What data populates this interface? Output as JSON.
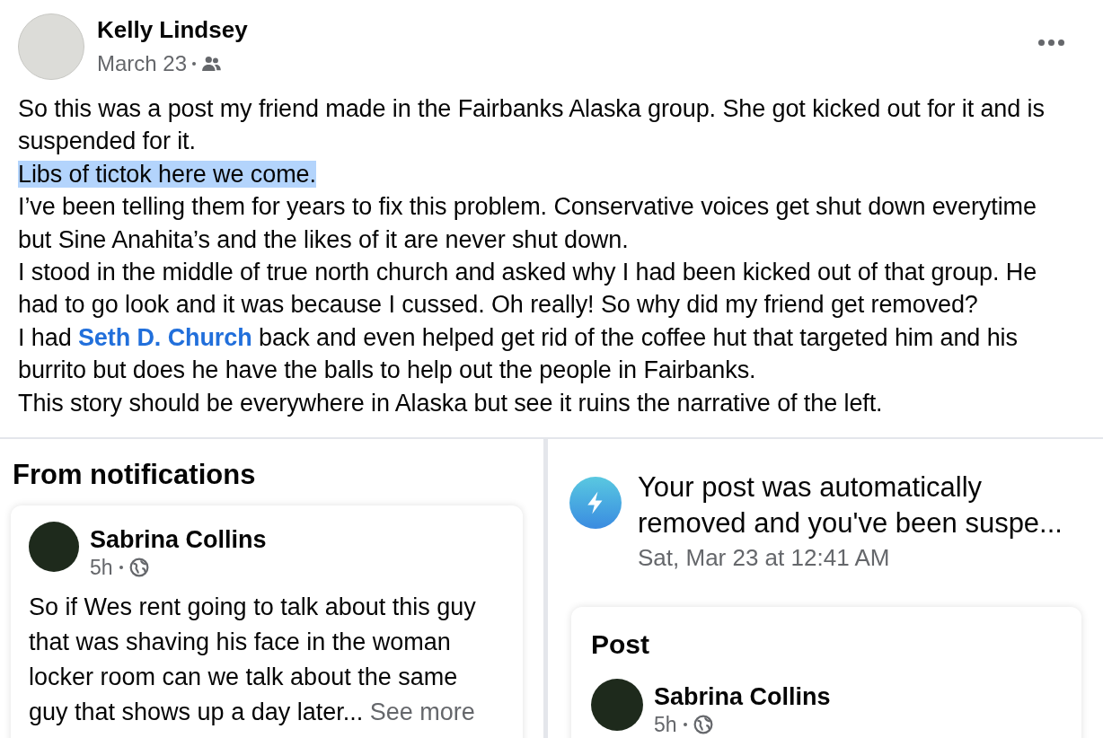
{
  "post": {
    "author": "Kelly Lindsey",
    "date": "March 23",
    "paragraphs": [
      {
        "highlighted": false,
        "parts": [
          {
            "kind": "text",
            "text": "So this was a post my friend made in the Fairbanks Alaska group. She got kicked out for it and is suspended for it."
          }
        ]
      },
      {
        "highlighted": true,
        "parts": [
          {
            "kind": "text",
            "text": "Libs of tictok here we come. "
          }
        ]
      },
      {
        "highlighted": false,
        "parts": [
          {
            "kind": "text",
            "text": "I’ve been telling them for years to fix this problem. Conservative voices get shut down everytime but Sine Anahita’s and the likes of it are never shut down."
          }
        ]
      },
      {
        "highlighted": false,
        "parts": [
          {
            "kind": "text",
            "text": "I stood in the middle of true north church and asked why I had been kicked out of that group. He had to go look and it was because I cussed. Oh really! So why did my friend get removed?"
          }
        ]
      },
      {
        "highlighted": false,
        "parts": [
          {
            "kind": "text",
            "text": "I had "
          },
          {
            "kind": "mention",
            "text": "Seth D. Church"
          },
          {
            "kind": "text",
            "text": " back and even helped get rid of the coffee hut that targeted him and his burrito but does he have the balls to help out the people in Fairbanks."
          }
        ]
      },
      {
        "highlighted": false,
        "parts": [
          {
            "kind": "text",
            "text": "This story should be everywhere in Alaska but see it ruins the narrative of the left."
          }
        ]
      }
    ]
  },
  "screenshot_left": {
    "heading": "From notifications",
    "card": {
      "author": "Sabrina Collins",
      "time": "5h",
      "text": "So if Wes rent going to talk about this guy that was shaving his face in the woman locker room can we talk about the same guy that shows up a day later...",
      "see_more": "See more"
    }
  },
  "screenshot_right": {
    "notification": "Your post was automatically removed and you've been suspe...",
    "timestamp": "Sat, Mar 23 at 12:41 AM",
    "card": {
      "heading": "Post",
      "author": "Sabrina Collins",
      "time": "5h"
    }
  }
}
